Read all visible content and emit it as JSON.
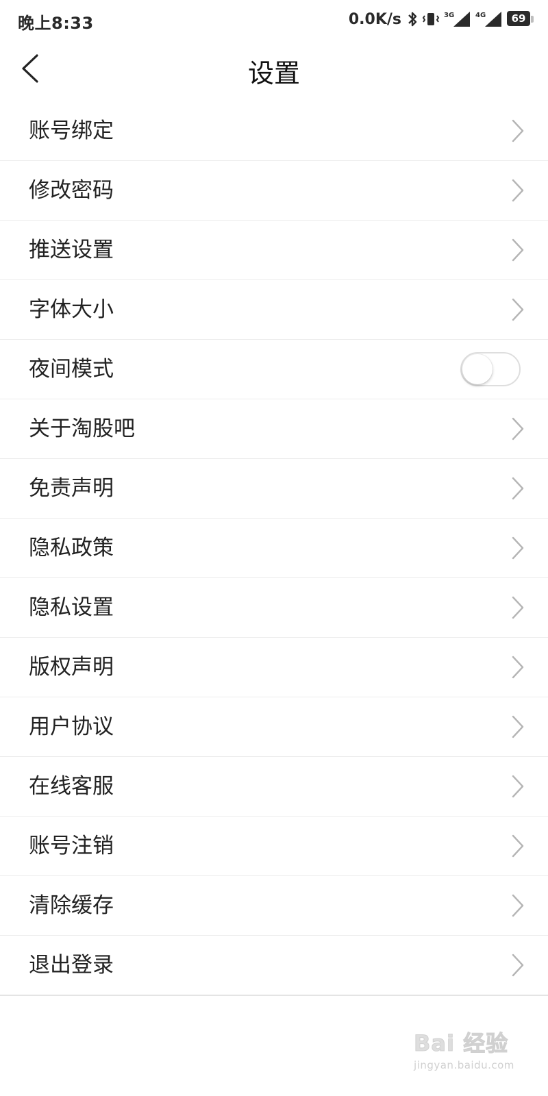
{
  "status_bar": {
    "time": "晚上8:33",
    "network_speed": "0.0K/s",
    "signal_1_label": "3G",
    "signal_2_label": "4G",
    "battery_level": "69",
    "icons": [
      "bluetooth-icon",
      "vibrate-icon",
      "signal-3g-icon",
      "signal-4g-icon",
      "battery-icon"
    ]
  },
  "header": {
    "title": "设置",
    "back_icon": "chevron-left-icon"
  },
  "settings": {
    "items": [
      {
        "label": "账号绑定",
        "control": "chevron"
      },
      {
        "label": "修改密码",
        "control": "chevron"
      },
      {
        "label": "推送设置",
        "control": "chevron"
      },
      {
        "label": "字体大小",
        "control": "chevron"
      },
      {
        "label": "夜间模式",
        "control": "toggle",
        "toggle_on": false
      },
      {
        "label": "关于淘股吧",
        "control": "chevron"
      },
      {
        "label": "免责声明",
        "control": "chevron"
      },
      {
        "label": "隐私政策",
        "control": "chevron"
      },
      {
        "label": "隐私设置",
        "control": "chevron"
      },
      {
        "label": "版权声明",
        "control": "chevron"
      },
      {
        "label": "用户协议",
        "control": "chevron"
      },
      {
        "label": "在线客服",
        "control": "chevron"
      },
      {
        "label": "账号注销",
        "control": "chevron"
      },
      {
        "label": "清除缓存",
        "control": "chevron"
      },
      {
        "label": "退出登录",
        "control": "chevron"
      }
    ]
  },
  "watermark": {
    "logo_text": "Bai 经验",
    "url": "jingyan.baidu.com"
  },
  "colors": {
    "background": "#ffffff",
    "text": "#222222",
    "divider": "#ececec",
    "chevron": "#b5b5b5"
  }
}
